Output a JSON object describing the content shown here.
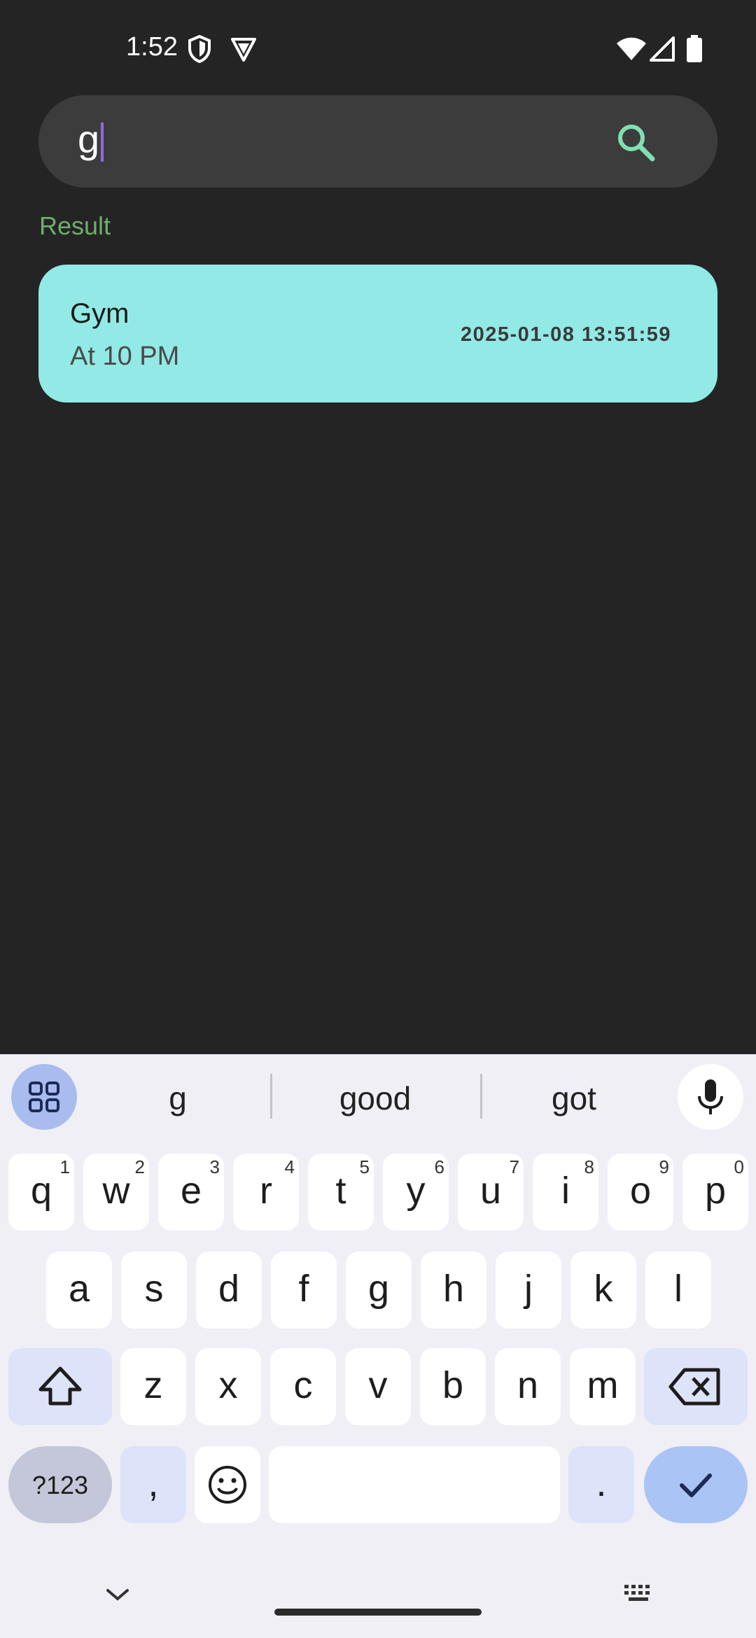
{
  "status_bar": {
    "time": "1:52",
    "icons": [
      "shield-icon",
      "vpn-icon",
      "wifi-icon",
      "signal-icon",
      "battery-icon"
    ]
  },
  "search": {
    "value": "g",
    "icon": "search-icon"
  },
  "results": {
    "label": "Result",
    "items": [
      {
        "title": "Gym",
        "subtitle": "At 10 PM",
        "datetime": "2025-01-08 13:51:59"
      }
    ]
  },
  "keyboard": {
    "suggestions": [
      "g",
      "good",
      "got"
    ],
    "row1": [
      {
        "k": "q",
        "h": "1"
      },
      {
        "k": "w",
        "h": "2"
      },
      {
        "k": "e",
        "h": "3"
      },
      {
        "k": "r",
        "h": "4"
      },
      {
        "k": "t",
        "h": "5"
      },
      {
        "k": "y",
        "h": "6"
      },
      {
        "k": "u",
        "h": "7"
      },
      {
        "k": "i",
        "h": "8"
      },
      {
        "k": "o",
        "h": "9"
      },
      {
        "k": "p",
        "h": "0"
      }
    ],
    "row2": [
      "a",
      "s",
      "d",
      "f",
      "g",
      "h",
      "j",
      "k",
      "l"
    ],
    "row3": [
      "z",
      "x",
      "c",
      "v",
      "b",
      "n",
      "m"
    ],
    "symbols_label": "?123",
    "comma": ",",
    "period": "."
  },
  "colors": {
    "background": "#242424",
    "card": "#92e9e5",
    "result_label": "#6fae6b",
    "search_icon": "#7fe0b0",
    "cursor": "#8e6cd9"
  }
}
